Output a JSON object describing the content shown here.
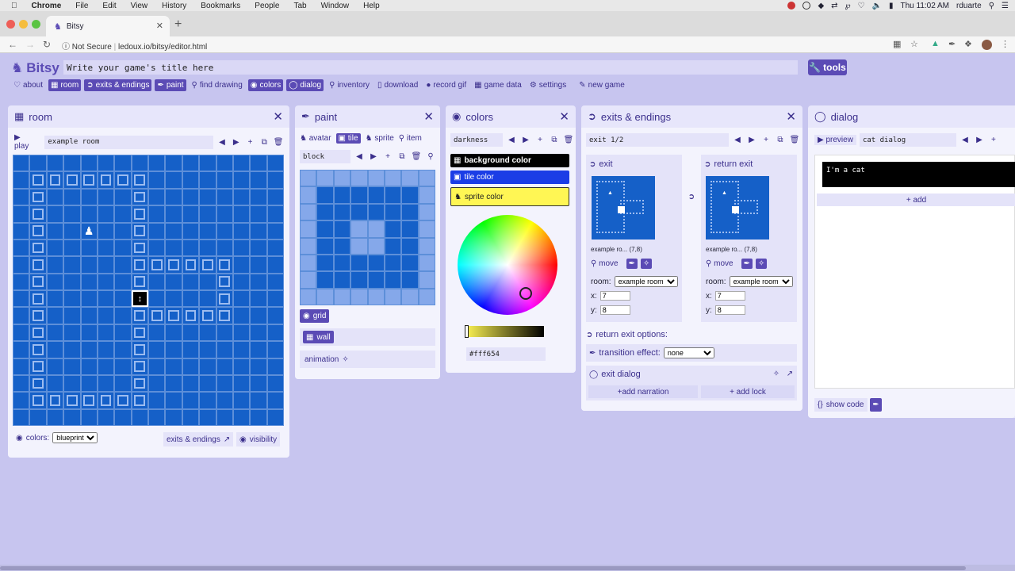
{
  "menubar": {
    "items": [
      "Chrome",
      "File",
      "Edit",
      "View",
      "History",
      "Bookmarks",
      "People",
      "Tab",
      "Window",
      "Help"
    ],
    "clock": "Thu 11:02 AM",
    "user": "rduarte"
  },
  "browser": {
    "tab_title": "Bitsy",
    "security": "Not Secure",
    "url": "ledoux.io/bitsy/editor.html"
  },
  "header": {
    "logo": "Bitsy",
    "title_value": "Write your game's title here",
    "tools_label": "tools",
    "toolbar": [
      {
        "label": "about",
        "icon": "heart-icon",
        "active": false
      },
      {
        "label": "room",
        "icon": "grid-icon",
        "active": true
      },
      {
        "label": "exits & endings",
        "icon": "exit-icon",
        "active": true
      },
      {
        "label": "paint",
        "icon": "brush-icon",
        "active": true
      },
      {
        "label": "find drawing",
        "icon": "magnifier-icon",
        "active": false
      },
      {
        "label": "colors",
        "icon": "palette-icon",
        "active": true
      },
      {
        "label": "dialog",
        "icon": "speech-icon",
        "active": true
      },
      {
        "label": "inventory",
        "icon": "key-icon",
        "active": false
      },
      {
        "label": "download",
        "icon": "file-icon",
        "active": false
      },
      {
        "label": "record gif",
        "icon": "record-icon",
        "active": false
      },
      {
        "label": "game data",
        "icon": "data-icon",
        "active": false
      },
      {
        "label": "settings",
        "icon": "gear-icon",
        "active": false
      },
      {
        "label": "new game",
        "icon": "new-icon",
        "active": false
      }
    ]
  },
  "room": {
    "title": "room",
    "play_label": "play",
    "room_name": "example room",
    "colors_label": "colors:",
    "palette_value": "blueprint",
    "exits_label": "exits & endings",
    "visibility_label": "visibility"
  },
  "paint": {
    "title": "paint",
    "tabs": [
      "avatar",
      "tile",
      "sprite",
      "item"
    ],
    "active_tab": "tile",
    "drawing_name": "block",
    "grid_label": "grid",
    "wall_label": "wall",
    "animation_label": "animation"
  },
  "colors": {
    "title": "colors",
    "palette_name": "darkness",
    "background_label": "background color",
    "tile_label": "tile color",
    "sprite_label": "sprite color",
    "hex_value": "#fff654",
    "background_color": "#000000",
    "tile_color": "#1b3de6",
    "sprite_color": "#fff654"
  },
  "exits": {
    "title": "exits & endings",
    "counter": "exit 1/2",
    "exit_label": "exit",
    "return_label": "return exit",
    "exit_caption": "example ro... (7,8)",
    "return_caption": "example ro... (7,8)",
    "move_label": "move",
    "room_label": "room:",
    "room_value": "example room",
    "x_label": "x:",
    "y_label": "y:",
    "x_value": "7",
    "y_value": "8",
    "return_options_label": "return exit options:",
    "transition_label": "transition effect:",
    "transition_value": "none",
    "exit_dialog_label": "exit dialog",
    "add_narration_label": "+add narration",
    "add_lock_label": "+ add lock"
  },
  "dialog": {
    "title": "dialog",
    "preview_label": "preview",
    "dialog_name": "cat dialog",
    "text": "I'm a cat",
    "add_label": "+ add",
    "show_code_label": "show code"
  }
}
